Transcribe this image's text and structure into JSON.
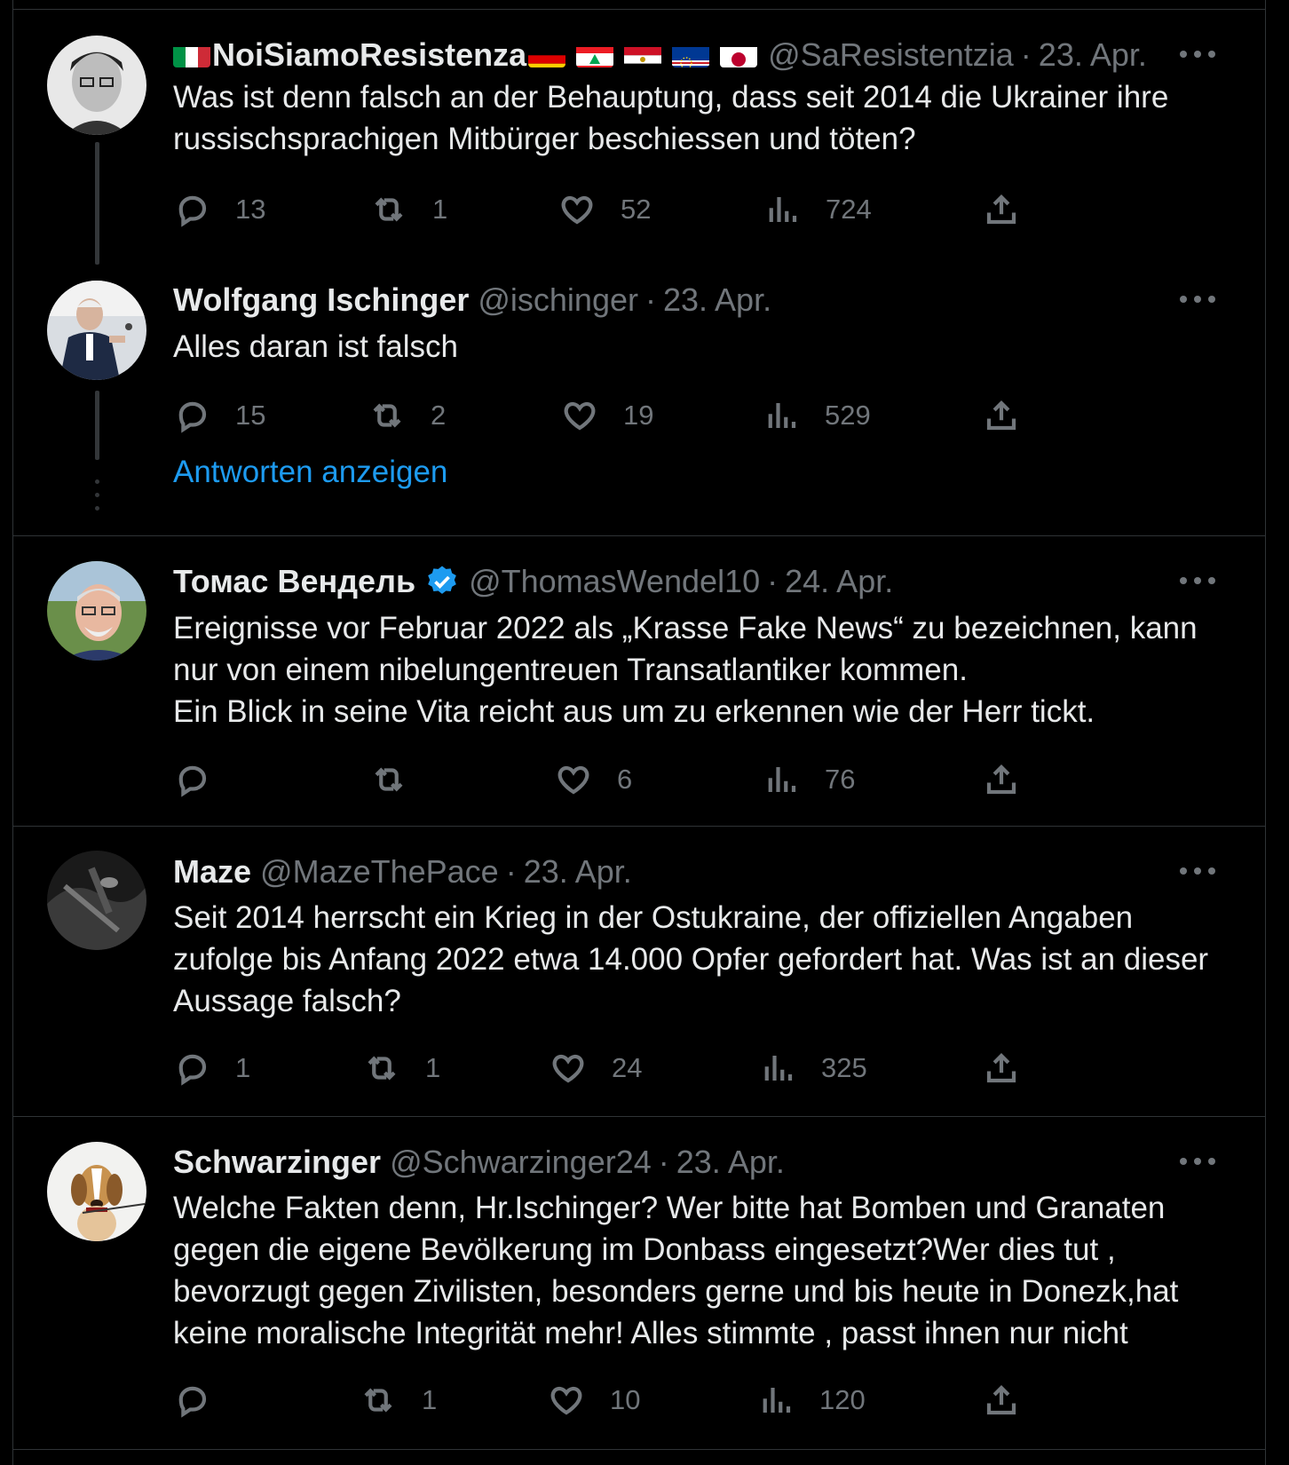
{
  "tweets": [
    {
      "name": "NoiSiamoResistenza",
      "handle": "@SaResistentzia",
      "date": "23. Apr.",
      "text": [
        "Was ist denn falsch an der Behauptung, dass seit 2014 die Ukrainer ihre russischsprachigen Mitbürger beschiessen und töten?"
      ],
      "replies": "13",
      "retweets": "1",
      "likes": "52",
      "views": "724"
    },
    {
      "name": "Wolfgang Ischinger",
      "handle": "@ischinger",
      "date": "23. Apr.",
      "text": [
        "Alles daran ist falsch"
      ],
      "replies": "15",
      "retweets": "2",
      "likes": "19",
      "views": "529"
    },
    {
      "name": "Томас Вендель",
      "handle": "@ThomasWendel10",
      "date": "24. Apr.",
      "text": [
        "Ereignisse vor Februar 2022 als „Krasse Fake News“ zu bezeichnen, kann nur von einem nibelungentreuen Transatlantiker kommen.",
        "Ein Blick in seine Vita reicht aus um zu erkennen wie der Herr tickt."
      ],
      "replies": "",
      "retweets": "",
      "likes": "6",
      "views": "76"
    },
    {
      "name": "Maze",
      "handle": "@MazeThePace",
      "date": "23. Apr.",
      "text": [
        "Seit 2014 herrscht ein Krieg in der Ostukraine, der offiziellen Angaben zufolge bis Anfang 2022 etwa 14.000 Opfer gefordert hat. Was ist an dieser Aussage falsch?"
      ],
      "replies": "1",
      "retweets": "1",
      "likes": "24",
      "views": "325"
    },
    {
      "name": "Schwarzinger",
      "handle": "@Schwarzinger24",
      "date": "23. Apr.",
      "text": [
        "Welche Fakten denn, Hr.Ischinger? Wer bitte hat Bomben und Granaten gegen die eigene Bevölkerung im Donbass eingesetzt?Wer dies tut , bevorzugt gegen Zivilisten, besonders gerne und bis heute in Donezk,hat keine moralische Integrität mehr! Alles stimmte , passt ihnen nur nicht"
      ],
      "replies": "",
      "retweets": "1",
      "likes": "10",
      "views": "120"
    }
  ],
  "show_replies_label": "Antworten anzeigen",
  "separator_dot": "·",
  "flags": [
    "italy-flag",
    "germany-flag",
    "lebanon-flag",
    "egypt-flag",
    "cape-verde-flag",
    "japan-flag"
  ],
  "colors": {
    "background": "#000000",
    "text": "#e7e9ea",
    "muted": "#71767b",
    "link": "#1d9bf0",
    "border": "#2f3336"
  }
}
